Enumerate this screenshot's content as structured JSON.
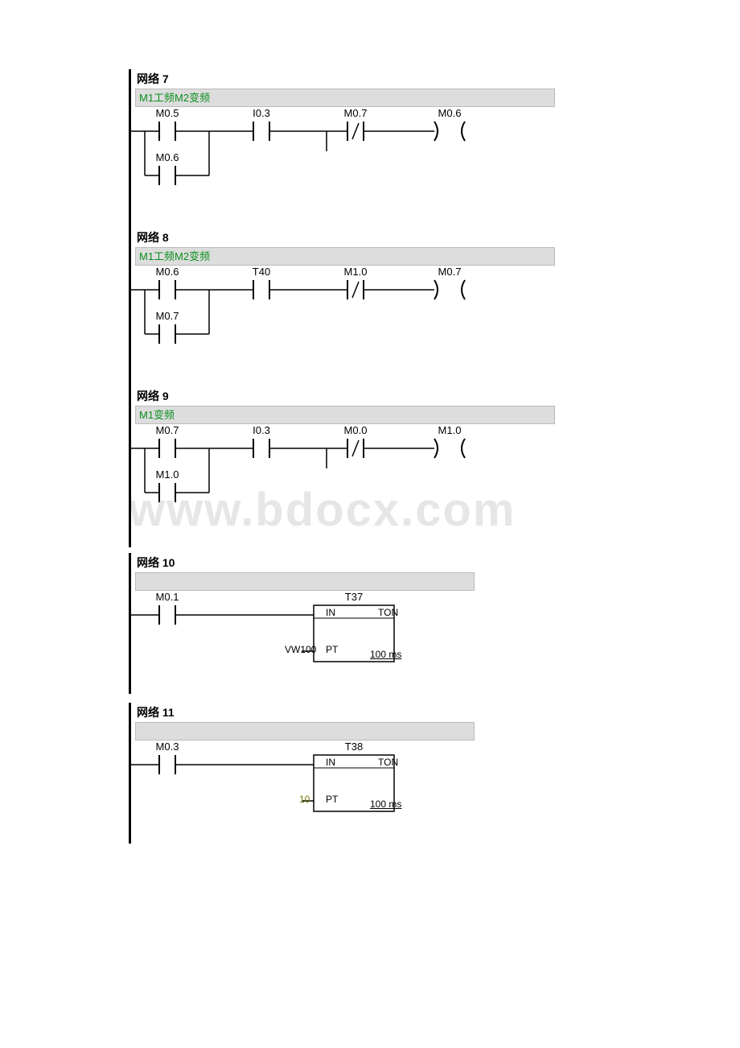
{
  "watermark": "www.bdocx.com",
  "networks": [
    {
      "id": "net7",
      "title": "网络 7",
      "comment": "M1工频M2变频",
      "contacts": {
        "c1": "M0.5",
        "c2": "I0.3",
        "c3": "M0.7",
        "coil": "M0.6",
        "branch": "M0.6"
      }
    },
    {
      "id": "net8",
      "title": "网络 8",
      "comment": "M1工频M2变频",
      "contacts": {
        "c1": "M0.6",
        "c2": "T40",
        "c3": "M1.0",
        "coil": "M0.7",
        "branch": "M0.7"
      }
    },
    {
      "id": "net9",
      "title": "网络 9",
      "comment": "M1变频",
      "contacts": {
        "c1": "M0.7",
        "c2": "I0.3",
        "c3": "M0.0",
        "coil": "M1.0",
        "branch": "M1.0"
      }
    },
    {
      "id": "net10",
      "title": "网络 10",
      "comment": "",
      "contacts": {
        "c1": "M0.1"
      },
      "timer": {
        "name": "T37",
        "type": "TON",
        "in": "IN",
        "pt_label": "PT",
        "pt_val": "VW100",
        "res": "100 ms"
      }
    },
    {
      "id": "net11",
      "title": "网络 11",
      "comment": "",
      "contacts": {
        "c1": "M0.3"
      },
      "timer": {
        "name": "T38",
        "type": "TON",
        "in": "IN",
        "pt_label": "PT",
        "pt_val": "10",
        "res": "100 ms"
      }
    }
  ]
}
